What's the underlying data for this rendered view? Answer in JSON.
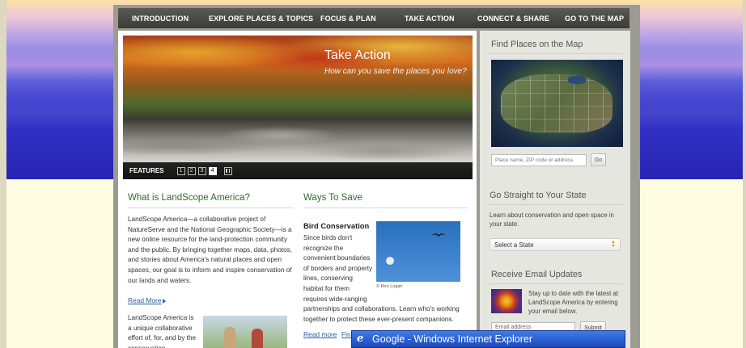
{
  "nav": {
    "items": [
      "INTRODUCTION",
      "EXPLORE PLACES & TOPICS",
      "FOCUS & PLAN",
      "TAKE ACTION",
      "CONNECT & SHARE",
      "GO TO THE MAP"
    ]
  },
  "hero": {
    "title": "Take Action",
    "subtitle": "How can you save the places you love?",
    "features_label": "FEATURES",
    "pages": [
      "1",
      "2",
      "3",
      "4"
    ],
    "active_page": "4"
  },
  "about": {
    "heading": "What is LandScope America?",
    "lines": [
      "LandScope America—a collaborative project of",
      "NatureServe and the National Geographic Society—is a",
      "new online resource for the land-protection community",
      "and the public. By bringing together maps, data, photos,",
      "and stories about America's natural places and open",
      "spaces, our goal is to inform and inspire conservation of",
      "our lands and waters."
    ],
    "read_more": "Read More",
    "extra_lines": [
      "LandScope America is",
      "a unique collaborative",
      "effort of, for, and by the",
      "conservation"
    ]
  },
  "ways": {
    "heading": "Ways To Save",
    "feature_title": "Bird Conservation",
    "narrow_lines": [
      "Since birds don't",
      "recognize the",
      "convenient boundaries",
      "of borders and property",
      "lines, conserving",
      "habitat for them",
      "requires wide-ranging"
    ],
    "wide_lines": [
      "partnerships and collaborations. Learn who's working",
      "together to protect these ever-present companions."
    ],
    "photo_credit": "© Ron Logan",
    "read_more": "Read more",
    "find_partial": "Find"
  },
  "sidebar": {
    "map_heading": "Find Places on the Map",
    "map_placeholder": "Place name, ZIP code or address",
    "go_label": "Go",
    "state_heading": "Go Straight to Your State",
    "state_text_lines": [
      "Learn about conservation and open space in",
      "your state."
    ],
    "state_select": "Select a State",
    "email_heading": "Receive Email Updates",
    "email_text_lines": [
      "Stay up to date with the latest at",
      "LandScope America by entering",
      "your email below."
    ],
    "email_placeholder": "Email address",
    "submit_label": "Submit"
  },
  "popup": {
    "title": "Google - Windows Internet Explorer"
  },
  "colors": {
    "heading_green": "#2f6b2f",
    "link_blue": "#2c5aa0",
    "nav_bg": "#3a3a37",
    "taskbar_blue": "#2a5fd0"
  }
}
